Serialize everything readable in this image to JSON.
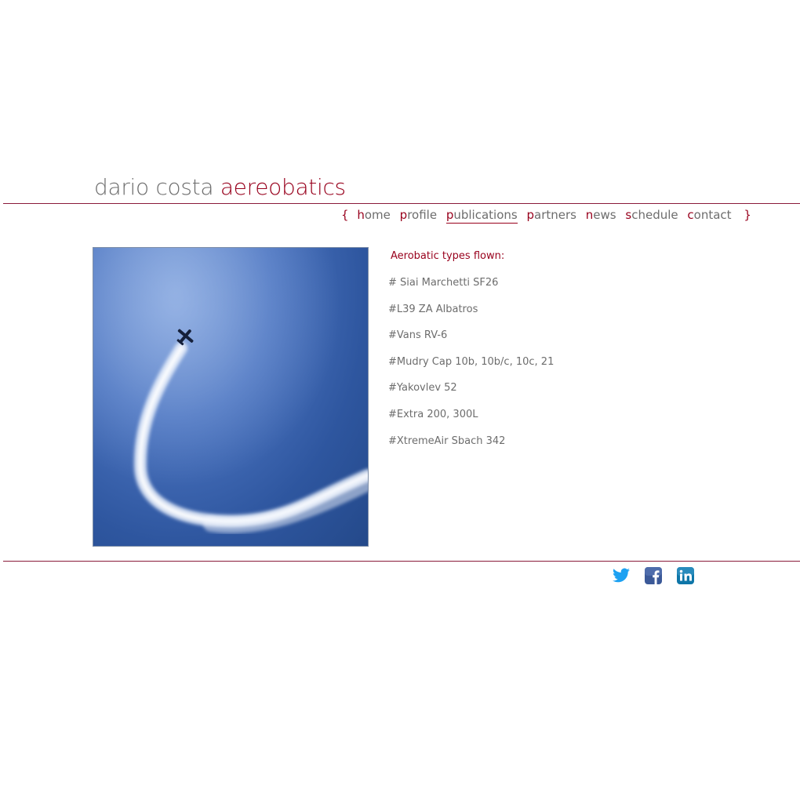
{
  "header": {
    "title_name": "dario costa",
    "title_accent": "aereobatics"
  },
  "nav": {
    "open_brace": "{",
    "close_brace": "}",
    "items": [
      {
        "first": "h",
        "rest": "ome"
      },
      {
        "first": "p",
        "rest": "rofile"
      },
      {
        "first": "p",
        "rest": "ublications"
      },
      {
        "first": "p",
        "rest": "artners"
      },
      {
        "first": "n",
        "rest": "ews"
      },
      {
        "first": "s",
        "rest": "chedule"
      },
      {
        "first": "c",
        "rest": "ontact"
      }
    ],
    "current": "publications"
  },
  "content": {
    "heading": "Aerobatic types flown:",
    "aircraft": [
      "# Siai Marchetti SF26",
      "#L39 ZA Albatros",
      "#Vans RV-6",
      "#Mudry Cap 10b, 10b/c, 10c, 21",
      "#Yakovlev 52",
      "#Extra 200, 300L",
      "#XtremeAir Sbach 342"
    ]
  },
  "social": {
    "icons": [
      "twitter-icon",
      "facebook-icon",
      "linkedin-icon"
    ]
  },
  "colors": {
    "accent": "#98001c",
    "text": "#6d6d6d",
    "twitter": "#1da1f2",
    "facebook": "#3b5998",
    "linkedin": "#0e76a8"
  }
}
